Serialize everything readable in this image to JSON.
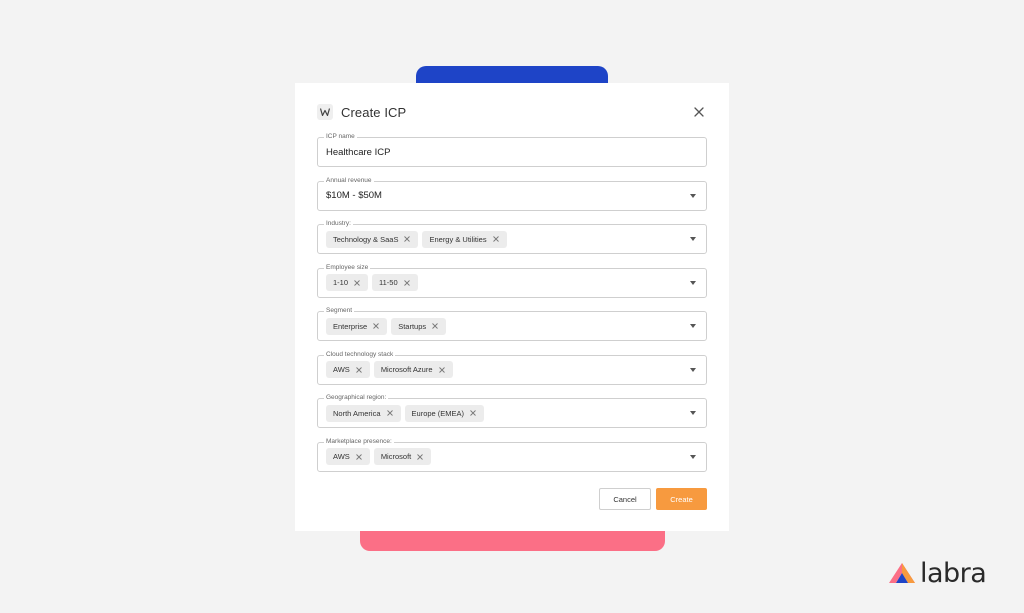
{
  "modal": {
    "title": "Create ICP",
    "icons": {
      "title": "logo-icon",
      "close": "close-icon"
    }
  },
  "fields": {
    "icp_name": {
      "label": "ICP name",
      "value": "Healthcare ICP"
    },
    "annual_revenue": {
      "label": "Annual revenue",
      "value": "$10M - $50M"
    },
    "industry": {
      "label": "Industry:",
      "chips": [
        "Technology & SaaS",
        "Energy & Utilities"
      ]
    },
    "employee_size": {
      "label": "Employee size",
      "chips": [
        "1-10",
        "11-50"
      ]
    },
    "segment": {
      "label": "Segment",
      "chips": [
        "Enterprise",
        "Startups"
      ]
    },
    "cloud_stack": {
      "label": "Cloud technology stack",
      "chips": [
        "AWS",
        "Microsoft Azure"
      ]
    },
    "geo_region": {
      "label": "Geographical region:",
      "chips": [
        "North America",
        "Europe (EMEA)"
      ]
    },
    "marketplace": {
      "label": "Marketplace presence:",
      "chips": [
        "AWS",
        "Microsoft"
      ]
    }
  },
  "actions": {
    "cancel_label": "Cancel",
    "create_label": "Create"
  },
  "brand": {
    "name": "labra"
  },
  "colors": {
    "accent": "#f79a3f",
    "blue_blob": "#1e44c7",
    "pink_blob": "#fb6f86",
    "chip_bg": "#ececec"
  }
}
